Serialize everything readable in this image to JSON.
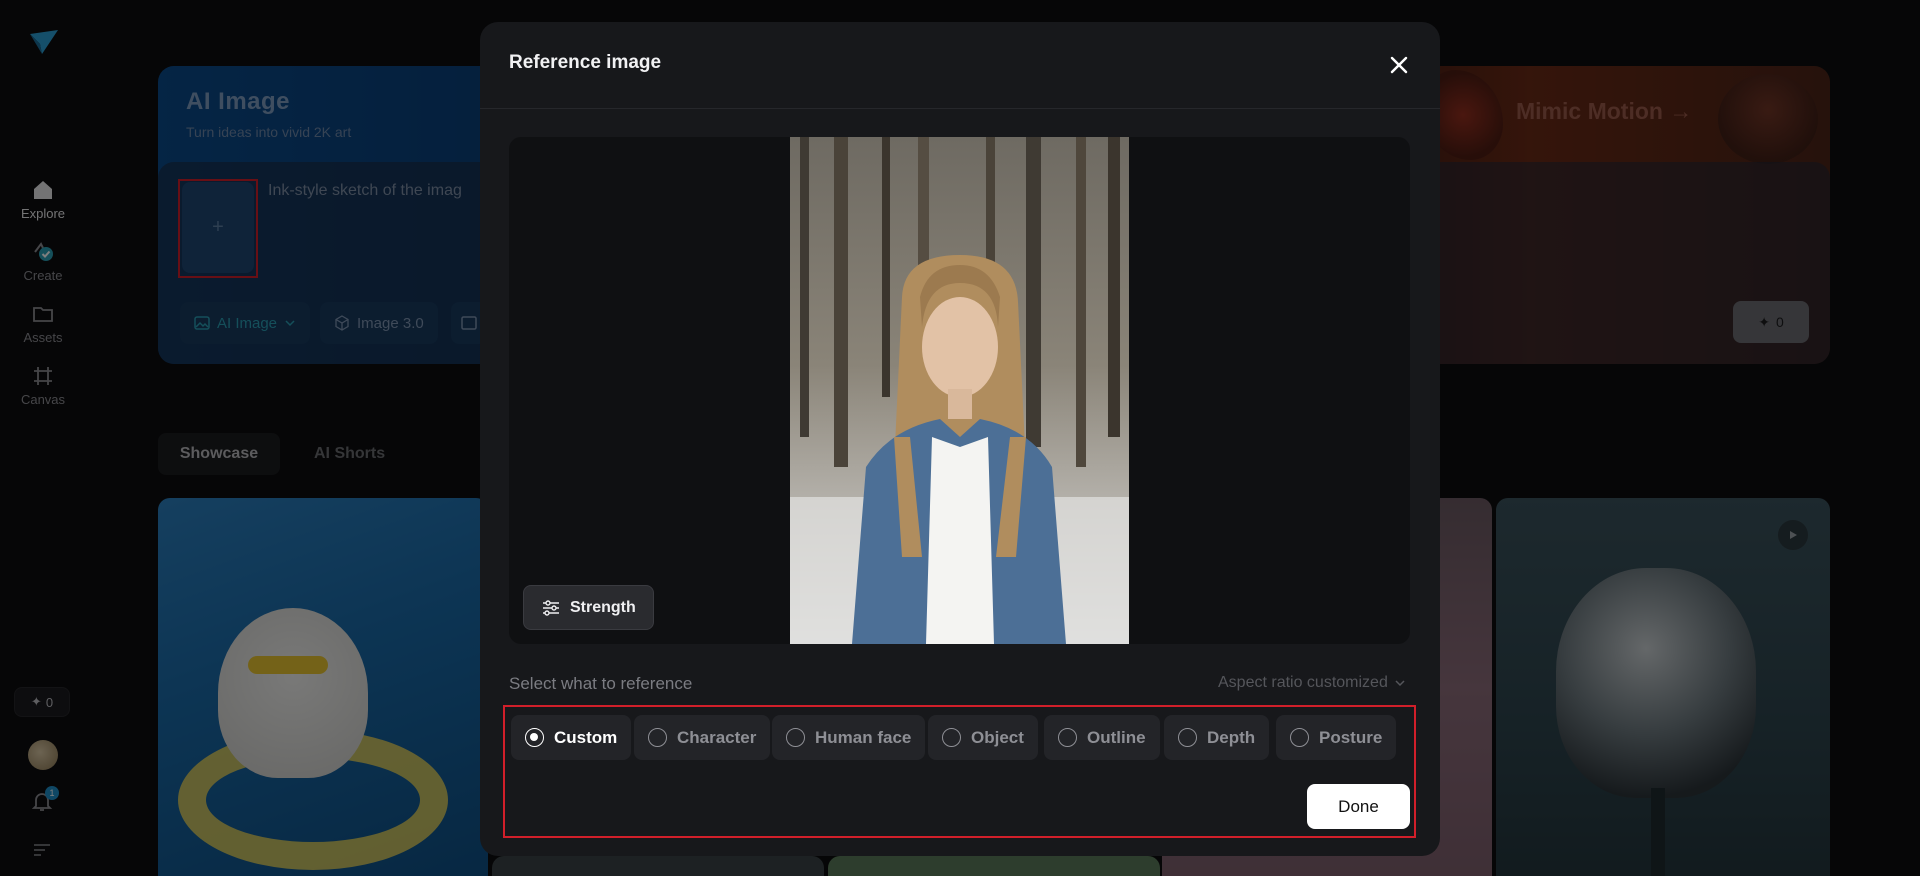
{
  "sidebar": {
    "logo": "logo-icon",
    "nav": [
      {
        "label": "Explore",
        "icon": "home-icon"
      },
      {
        "label": "Create",
        "icon": "create-icon"
      },
      {
        "label": "Assets",
        "icon": "folder-icon"
      },
      {
        "label": "Canvas",
        "icon": "canvas-icon"
      }
    ],
    "credits": "0",
    "notification_count": "1"
  },
  "hero": {
    "title": "AI Image",
    "subtitle": "Turn ideas into vivid 2K art",
    "promo": "Mimic Motion →",
    "prompt_text": "Ink-style sketch of the imag",
    "upload_symbol": "+",
    "mode_pill": "AI Image",
    "model_pill": "Image 3.0",
    "generate_credits": "0"
  },
  "tabs": [
    {
      "label": "Showcase"
    },
    {
      "label": "AI Shorts"
    }
  ],
  "modal": {
    "title": "Reference image",
    "strength_label": "Strength",
    "select_label": "Select what to reference",
    "aspect_label": "Aspect ratio customized",
    "options": [
      {
        "label": "Custom",
        "selected": true
      },
      {
        "label": "Character",
        "selected": false
      },
      {
        "label": "Human face",
        "selected": false
      },
      {
        "label": "Object",
        "selected": false
      },
      {
        "label": "Outline",
        "selected": false
      },
      {
        "label": "Depth",
        "selected": false
      },
      {
        "label": "Posture",
        "selected": false
      }
    ],
    "done_label": "Done"
  },
  "colors": {
    "accent": "#1f8fc9",
    "highlight_outline": "#d11f2a",
    "modal_bg": "#17181b"
  }
}
